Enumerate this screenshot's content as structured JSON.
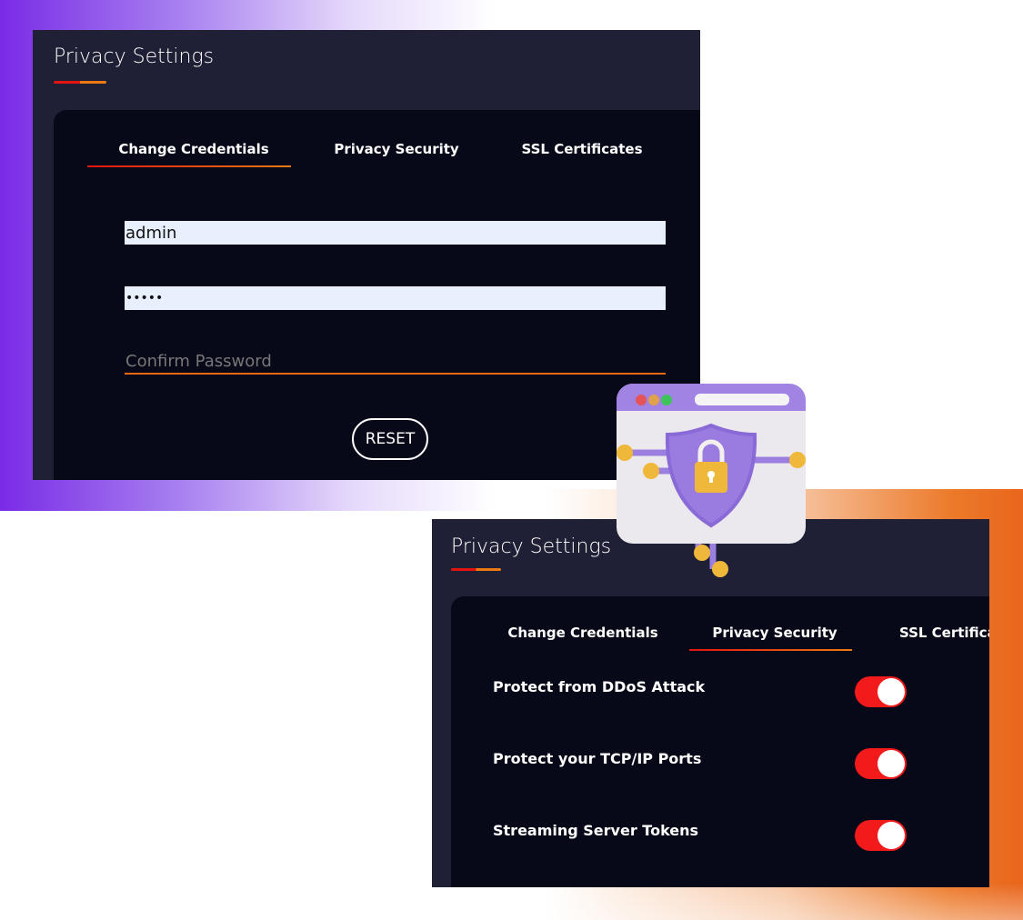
{
  "panel_top": {
    "title": "Privacy Settings",
    "tabs": [
      "Change Credentials",
      "Privacy Security",
      "SSL Certificates"
    ],
    "active_tab": "Change Credentials",
    "username_value": "admin",
    "password_value": "•••••",
    "confirm_placeholder": "Confirm Password",
    "reset_label": "RESET"
  },
  "panel_bottom": {
    "title": "Privacy Settings",
    "tabs": [
      "Change Credentials",
      "Privacy Security",
      "SSL Certificate"
    ],
    "active_tab": "Privacy Security",
    "settings": [
      {
        "label": "Protect from DDoS Attack",
        "enabled": true
      },
      {
        "label": "Protect your TCP/IP Ports",
        "enabled": true
      },
      {
        "label": "Streaming Server Tokens",
        "enabled": true
      }
    ]
  },
  "colors": {
    "accent_red": "#e3140f",
    "accent_orange": "#ec7a12",
    "toggle_on": "#f21a1a",
    "panel": "#1f2035",
    "card": "#070818"
  },
  "illustration": "browser-shield-lock-icon"
}
